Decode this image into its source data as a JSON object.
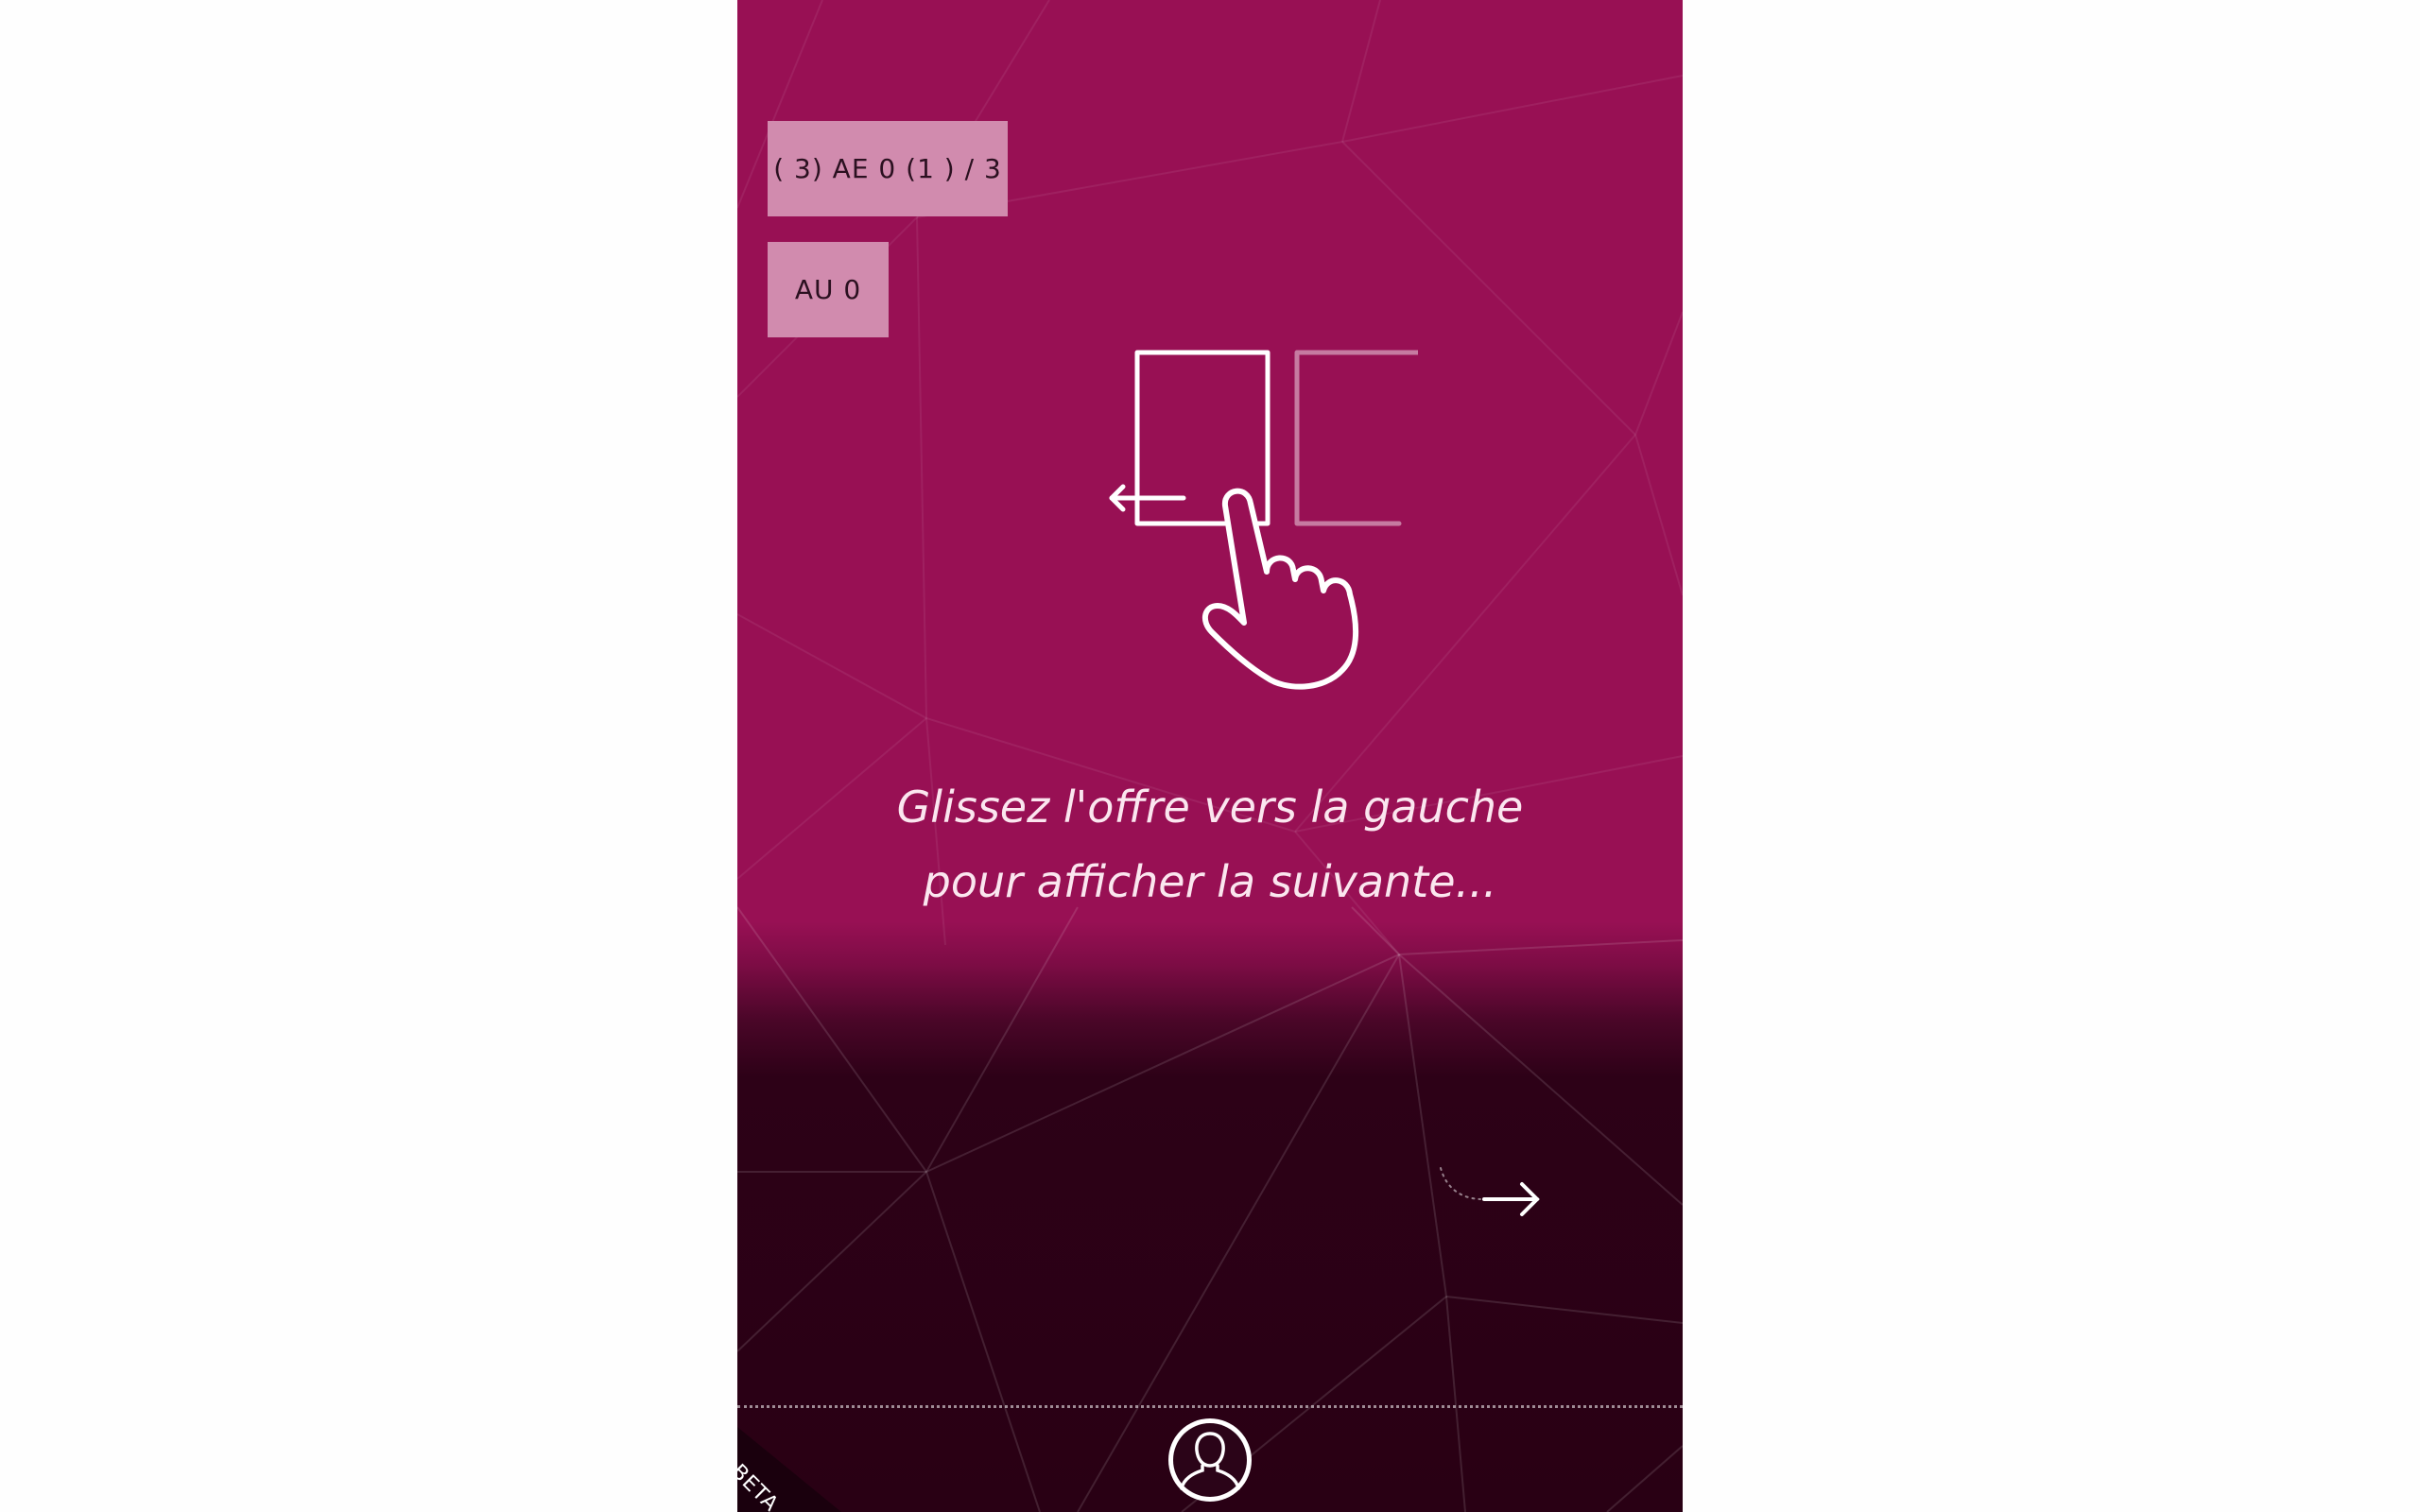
{
  "badges": {
    "score_label": "( 3) AE 0 (1 ) / 3",
    "au_label": "AU 0"
  },
  "instruction": {
    "line1": "Glissez l'offre vers la gauche",
    "line2": "pour afficher la suivante..."
  },
  "icons": {
    "swipe": "swipe-left-hand-icon",
    "next": "arrow-right-icon",
    "profile": "user-profile-icon"
  },
  "beta": {
    "label": "BETA"
  },
  "colors": {
    "primary": "#981054",
    "dark": "#290014",
    "badge_bg": "#d18bae"
  }
}
